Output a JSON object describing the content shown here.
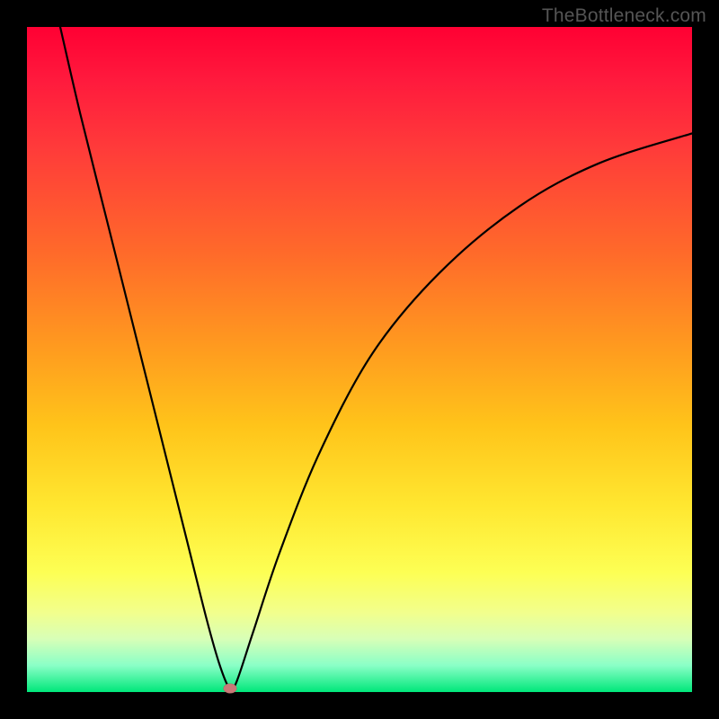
{
  "watermark": "TheBottleneck.com",
  "chart_data": {
    "type": "line",
    "title": "",
    "xlabel": "",
    "ylabel": "",
    "xlim": [
      0,
      100
    ],
    "ylim": [
      0,
      100
    ],
    "gradient_meaning": "background gradient from red (top, high bottleneck) to green (bottom, low bottleneck)",
    "series": [
      {
        "name": "bottleneck-curve",
        "x": [
          5,
          8,
          12,
          16,
          20,
          24,
          27,
          29,
          30.5,
          31.5,
          34,
          38,
          44,
          52,
          62,
          74,
          86,
          100
        ],
        "y": [
          100,
          87,
          71,
          55,
          39,
          23,
          11,
          4,
          0.5,
          1.5,
          9,
          21,
          36,
          51,
          63,
          73,
          79.5,
          84
        ]
      }
    ],
    "marker": {
      "x": 30.5,
      "y": 0.5,
      "color": "#c97a78"
    },
    "colors": {
      "curve": "#000000",
      "marker": "#c97a78",
      "gradient_top": "#ff0033",
      "gradient_bottom": "#00e77a",
      "frame": "#000000"
    }
  }
}
